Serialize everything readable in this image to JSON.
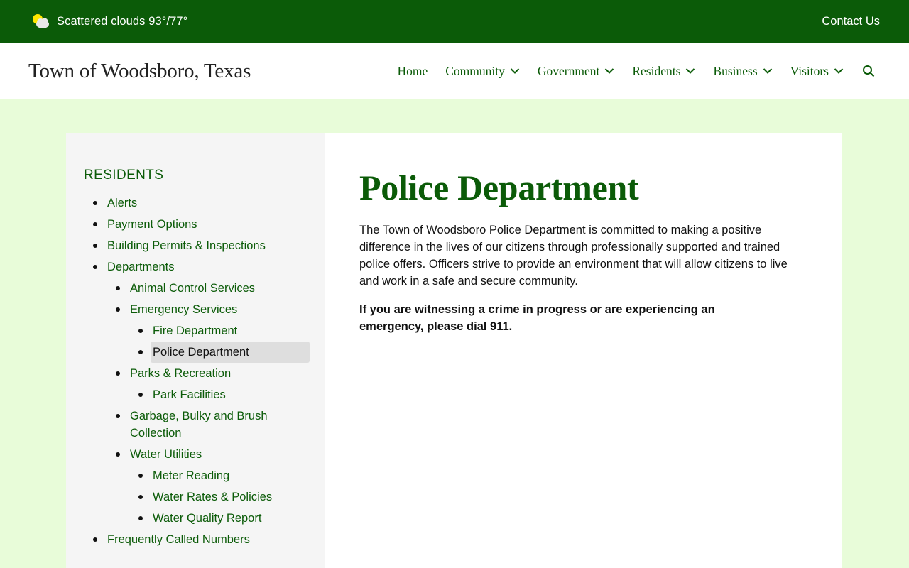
{
  "topbar": {
    "weather_text": "Scattered clouds 93°/77°",
    "weather_icon": "partly-cloudy-icon",
    "contact_label": "Contact Us"
  },
  "header": {
    "site_title": "Town of Woodsboro, Texas",
    "nav": [
      {
        "label": "Home",
        "dropdown": false
      },
      {
        "label": "Community",
        "dropdown": true
      },
      {
        "label": "Government",
        "dropdown": true
      },
      {
        "label": "Residents",
        "dropdown": true
      },
      {
        "label": "Business",
        "dropdown": true
      },
      {
        "label": "Visitors",
        "dropdown": true
      }
    ],
    "search_icon": "search-icon"
  },
  "sidebar": {
    "heading": "RESIDENTS",
    "items": {
      "alerts": "Alerts",
      "payment_options": "Payment Options",
      "building_permits": "Building Permits & Inspections",
      "departments": "Departments",
      "animal_control": "Animal Control Services",
      "emergency_services": "Emergency Services",
      "fire_department": "Fire Department",
      "police_department": "Police Department",
      "parks_recreation": "Parks & Recreation",
      "park_facilities": "Park Facilities",
      "garbage": "Garbage, Bulky and Brush Collection",
      "water_utilities": "Water Utilities",
      "meter_reading": "Meter Reading",
      "water_rates": "Water Rates & Policies",
      "water_quality": "Water Quality Report",
      "frequently_called": "Frequently Called Numbers"
    }
  },
  "main": {
    "title": "Police Department",
    "intro": "The Town of Woodsboro Police Department is committed to making a positive difference in the lives of our citizens through professionally supported and trained police offers. Officers strive to provide an environment that will allow citizens to live and work in a safe and secure community.",
    "emergency": "If you are witnessing a crime in progress or are experiencing an emergency, please dial 911."
  },
  "colors": {
    "brand_green": "#0b5b08",
    "page_background": "#e8fcd9",
    "sidebar_background": "#f5f5f5",
    "active_item_background": "#dedede"
  }
}
